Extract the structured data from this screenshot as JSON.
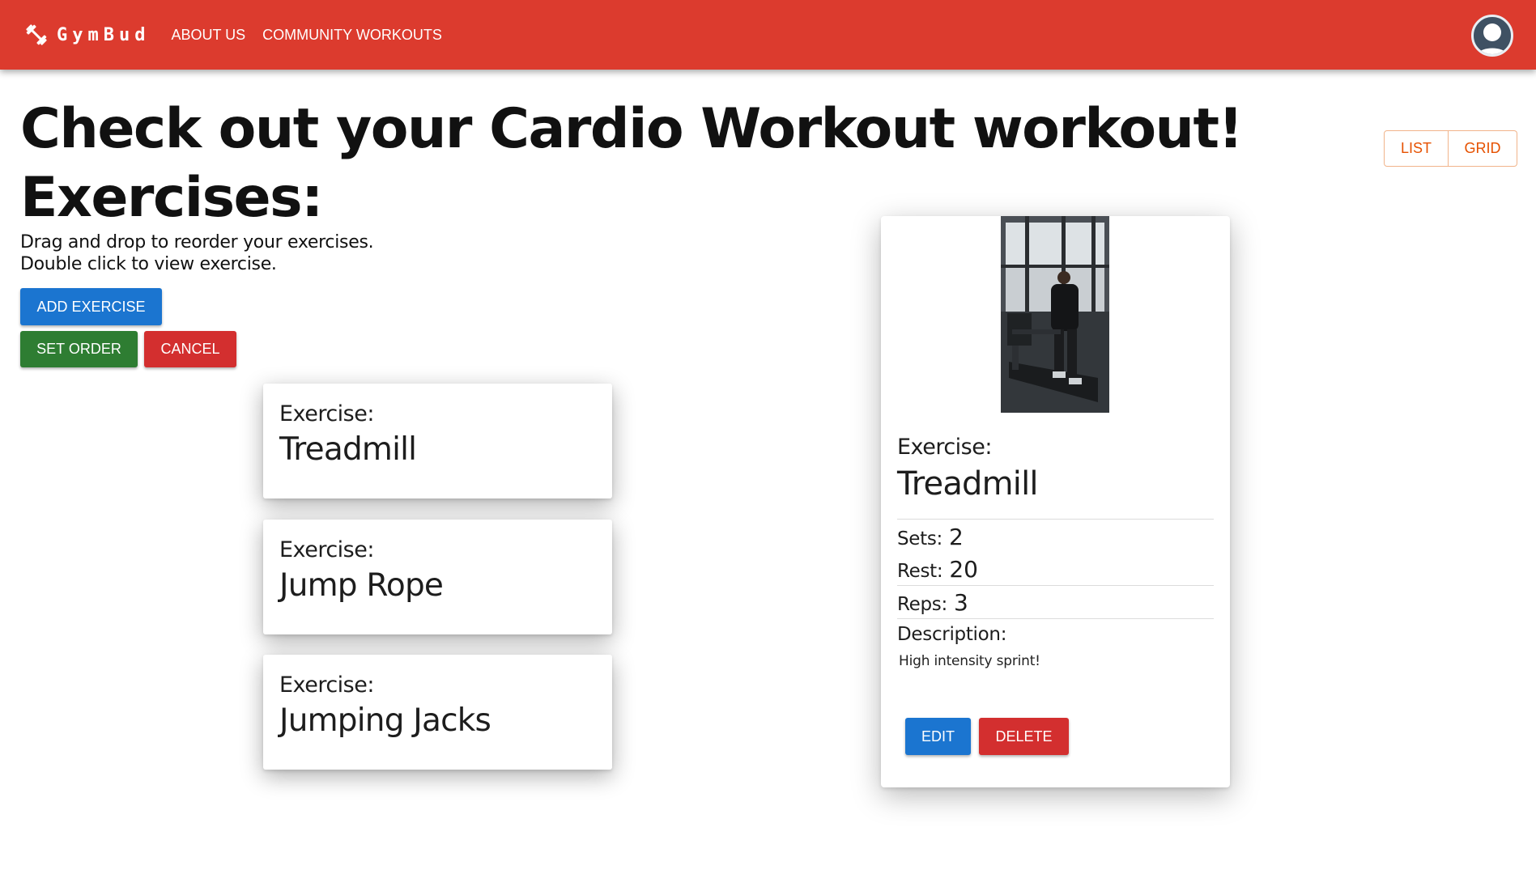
{
  "app": {
    "brand": "GymBud",
    "brand_icon": "dumbbell-icon",
    "accent_color": "#dc3b2e"
  },
  "nav": {
    "links": [
      "ABOUT US",
      "COMMUNITY WORKOUTS"
    ],
    "profile_icon": "user-avatar-icon"
  },
  "page": {
    "title": "Check out your Cardio Workout workout!",
    "section_title": "Exercises:",
    "instructions": [
      "Drag and drop to reorder your exercises.",
      "Double click to view exercise."
    ]
  },
  "actions": {
    "add_exercise": "ADD EXERCISE",
    "set_order": "SET ORDER",
    "cancel": "CANCEL"
  },
  "view_toggle": {
    "list": "LIST",
    "grid": "GRID"
  },
  "exercises": [
    {
      "label": "Exercise:",
      "name": "Treadmill"
    },
    {
      "label": "Exercise:",
      "name": "Jump Rope"
    },
    {
      "label": "Exercise:",
      "name": "Jumping Jacks"
    }
  ],
  "selected_exercise": {
    "image": "treadmill-photo",
    "label": "Exercise:",
    "name": "Treadmill",
    "sets_label": "Sets:",
    "sets": "2",
    "rest_label": "Rest:",
    "rest": "20",
    "reps_label": "Reps:",
    "reps": "3",
    "description_label": "Description:",
    "description": "High intensity sprint!",
    "edit": "EDIT",
    "delete": "DELETE"
  }
}
